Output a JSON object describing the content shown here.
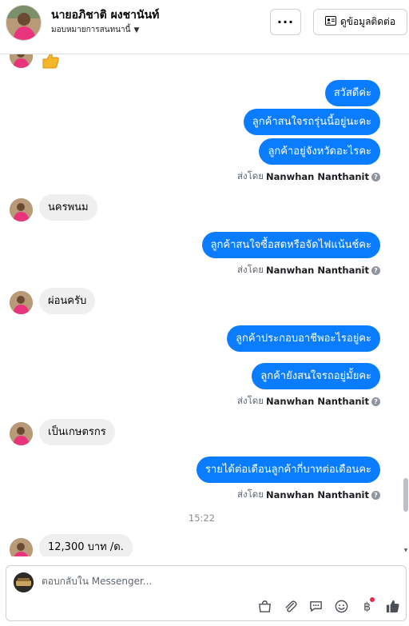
{
  "header": {
    "contact_name": "นายอภิชาติ ผงชานันท์",
    "assign_label": "มอบหมายการสนทนานี้",
    "more_label": "···",
    "contact_info_label": "ดูข้อมูลติดต่อ",
    "icons": {
      "avatar": "avatar",
      "caret": "chevron-down-icon",
      "more": "more-icon",
      "contact": "contact-card-icon"
    }
  },
  "messages": {
    "items": [
      {
        "type": "in",
        "content": "emoji",
        "emoji": "thumbs-up"
      },
      {
        "type": "out",
        "text": "สวัสดีค่ะ"
      },
      {
        "type": "out",
        "text": "ลูกค้าสนใจรถรุ่นนี้อยู่นะคะ"
      },
      {
        "type": "out",
        "text": "ลูกค้าอยู่จังหวัดอะไรคะ"
      },
      {
        "type": "sent_by",
        "prefix": "ส่งโดย",
        "name": "Nanwhan Nanthanit"
      },
      {
        "type": "in",
        "text": "นครพนม"
      },
      {
        "type": "out",
        "text": "ลูกค้าสนใจซื้อสดหรือจัดไฟแน้นช์คะ"
      },
      {
        "type": "sent_by",
        "prefix": "ส่งโดย",
        "name": "Nanwhan Nanthanit"
      },
      {
        "type": "in",
        "text": "ผ่อนครับ"
      },
      {
        "type": "out",
        "text": "ลูกค้าประกอบอาชีพอะไรอยู่คะ"
      },
      {
        "type": "out",
        "text": "ลูกค้ายังสนใจรถอยู่มั้ยคะ"
      },
      {
        "type": "sent_by",
        "prefix": "ส่งโดย",
        "name": "Nanwhan Nanthanit"
      },
      {
        "type": "in",
        "text": "เป็นเกษตรกร"
      },
      {
        "type": "out",
        "text": "รายได้ต่อเดือนลูกค้ากี่บาทต่อเดือนคะ"
      },
      {
        "type": "sent_by",
        "prefix": "ส่งโดย",
        "name": "Nanwhan Nanthanit"
      },
      {
        "type": "timestamp",
        "text": "15:22"
      },
      {
        "type": "in",
        "text": "12,300  บาท /ด."
      }
    ]
  },
  "composer": {
    "placeholder": "ตอบกลับใน Messenger...",
    "tools": [
      "shop-icon",
      "attachment-icon",
      "saved-replies-icon",
      "emoji-icon",
      "payment-icon",
      "like-icon"
    ]
  },
  "colors": {
    "outgoing_bubble": "#0a7cff",
    "incoming_bubble": "#efeff0",
    "notification_dot": "#f02849"
  }
}
